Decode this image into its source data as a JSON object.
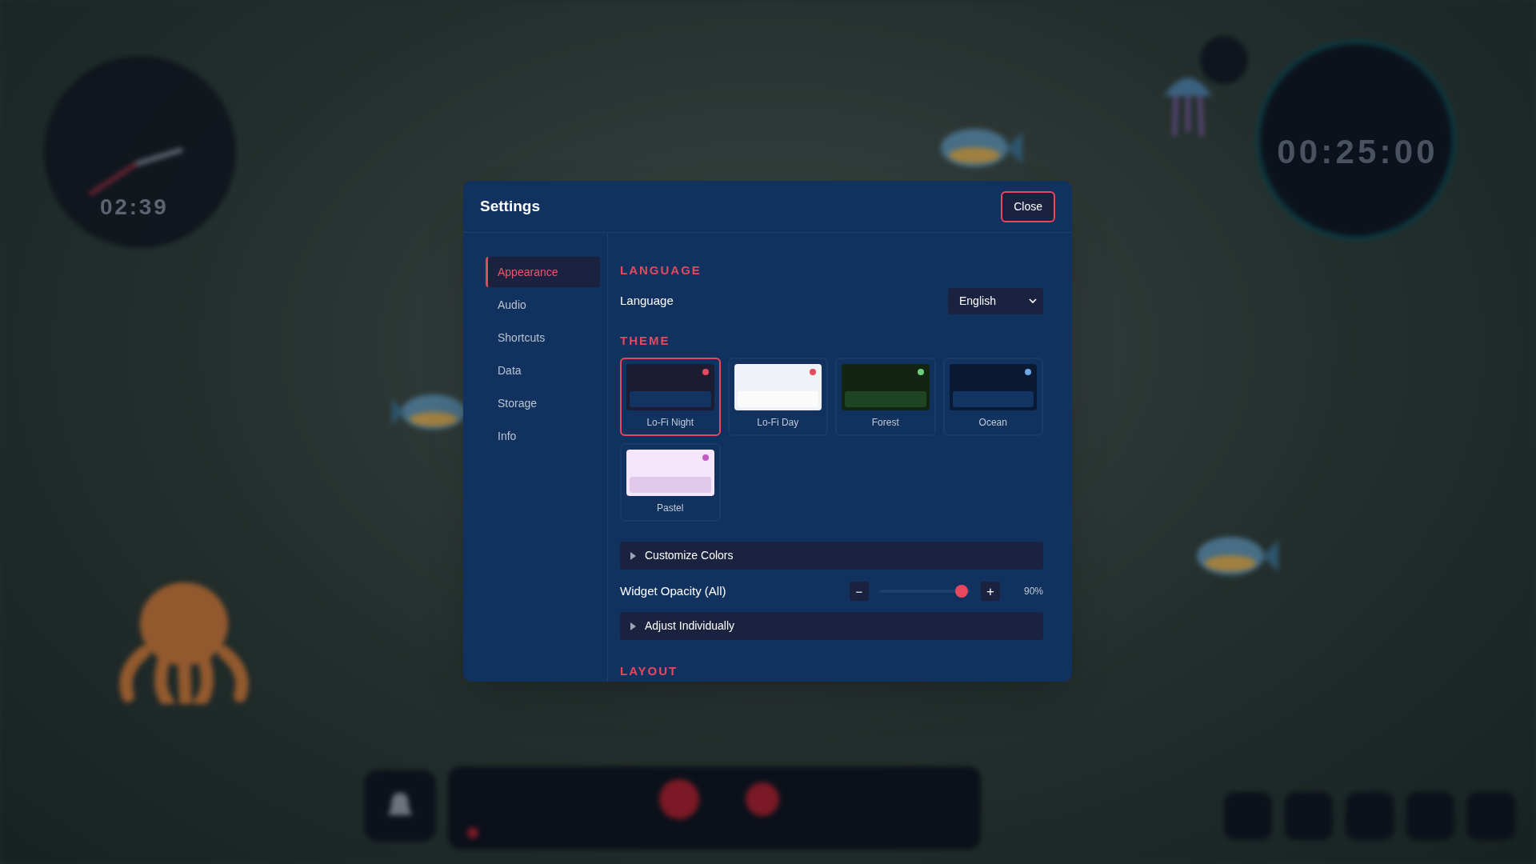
{
  "background": {
    "clock_widget": {
      "time": "02:39"
    },
    "timer_widget": {
      "time": "00:25:00"
    }
  },
  "dialog": {
    "title": "Settings",
    "close_button": "Close",
    "sidebar": {
      "items": [
        {
          "label": "Appearance",
          "selected": true
        },
        {
          "label": "Audio",
          "selected": false
        },
        {
          "label": "Shortcuts",
          "selected": false
        },
        {
          "label": "Data",
          "selected": false
        },
        {
          "label": "Storage",
          "selected": false
        },
        {
          "label": "Info",
          "selected": false
        }
      ]
    },
    "language_section": {
      "heading": "LANGUAGE",
      "label": "Language",
      "value": "English"
    },
    "theme_section": {
      "heading": "THEME",
      "themes": [
        {
          "name": "Lo-Fi Night",
          "selected": true,
          "color": "#e8485f",
          "preview": {
            "color": "#1c1d33"
          },
          "bar": {
            "color": "#123463"
          }
        },
        {
          "name": "Lo-Fi Day",
          "selected": false,
          "color": "#e8485f",
          "preview": {
            "color": "#eef1f6"
          },
          "bar": {
            "color": "#fbfbfc"
          }
        },
        {
          "name": "Forest",
          "selected": false,
          "color": "#6fce7e",
          "preview": {
            "color": "#112512"
          },
          "bar": {
            "color": "#1f4423"
          }
        },
        {
          "name": "Ocean",
          "selected": false,
          "color": "#6aa8e6",
          "preview": {
            "color": "#0b1a33"
          },
          "bar": {
            "color": "#123463"
          }
        },
        {
          "name": "Pastel",
          "selected": false,
          "color": "#c35bc4",
          "preview": {
            "color": "#f6e6fb"
          },
          "bar": {
            "color": "#e2c8ea"
          }
        }
      ]
    },
    "customize_colors": {
      "label": "Customize Colors",
      "expanded": false
    },
    "widget_opacity": {
      "label": "Widget Opacity (All)",
      "minus": "−",
      "plus": "+",
      "level": 0.9,
      "reading": "90%"
    },
    "adjust_individually": {
      "label": "Adjust Individually",
      "expanded": false
    },
    "layout_section": {
      "heading": "LAYOUT"
    }
  }
}
